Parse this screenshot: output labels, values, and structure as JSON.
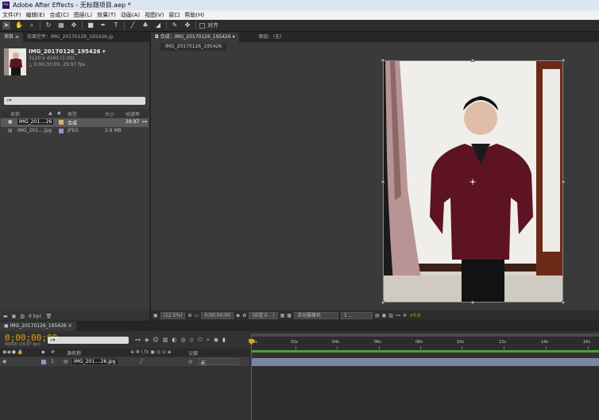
{
  "window": {
    "app_icon": "Ae",
    "title": "Adobe After Effects - 无标题项目.aep *"
  },
  "menu": [
    "文件(F)",
    "编辑(E)",
    "合成(C)",
    "图层(L)",
    "效果(T)",
    "动画(A)",
    "视图(V)",
    "窗口",
    "帮助(H)"
  ],
  "toolbar": {
    "align_label": "对齐"
  },
  "project": {
    "tab_label": "项目 ≡",
    "effect_tab": "效果控件：IMG_20170126_195426.jp",
    "item_name": "IMG_20170126_195426 ▾",
    "item_dims": "3120 x 4160 (1.00)",
    "item_duration": "△ 0;00;30;00, 29.97 fps",
    "search_icon": "⌕▾",
    "columns": {
      "name": "名称",
      "type": "类型",
      "size": "大小",
      "fps": "帧速率"
    },
    "rows": [
      {
        "name": "IMG_201....26",
        "type": "合成",
        "size": "",
        "fps": "29.97",
        "color": "#d8b070"
      },
      {
        "name": "IMG_201....jpg",
        "type": "JPEG",
        "size": "2.9 MB",
        "fps": "",
        "color": "#8b97c9"
      }
    ],
    "bpc": "8 bpc"
  },
  "viewer": {
    "comp_tab": "合成：IMG_20170126_195426",
    "layer_tab": "图层：(无)",
    "subtab": "IMG_20170126_195426",
    "zoom": "(12.5%)",
    "timecode": "0;00;00;00",
    "resolution": "(自定义...)",
    "camera": "活动摄像机",
    "views": "1 ...",
    "exposure": "+0.0"
  },
  "timeline": {
    "tab_label": "IMG_20170126_195426",
    "timecode": "0;00;00;00",
    "frame_info": "00000 (29.97 fps)",
    "search_icon": "⌕▾",
    "columns": {
      "num": "#",
      "source": "源名称",
      "parent": "父级"
    },
    "layer": {
      "num": "1",
      "name": "IMG_201....26.jpg",
      "parent": "无"
    },
    "ruler_labels": [
      "0s",
      "02s",
      "04s",
      "06s",
      "08s",
      "10s",
      "12s",
      "14s",
      "16s"
    ]
  },
  "colors": {
    "accent_orange": "#e8a000",
    "playhead": "#c83232",
    "work_area": "#4d9d42",
    "layer_bar": "#8a93b8"
  }
}
